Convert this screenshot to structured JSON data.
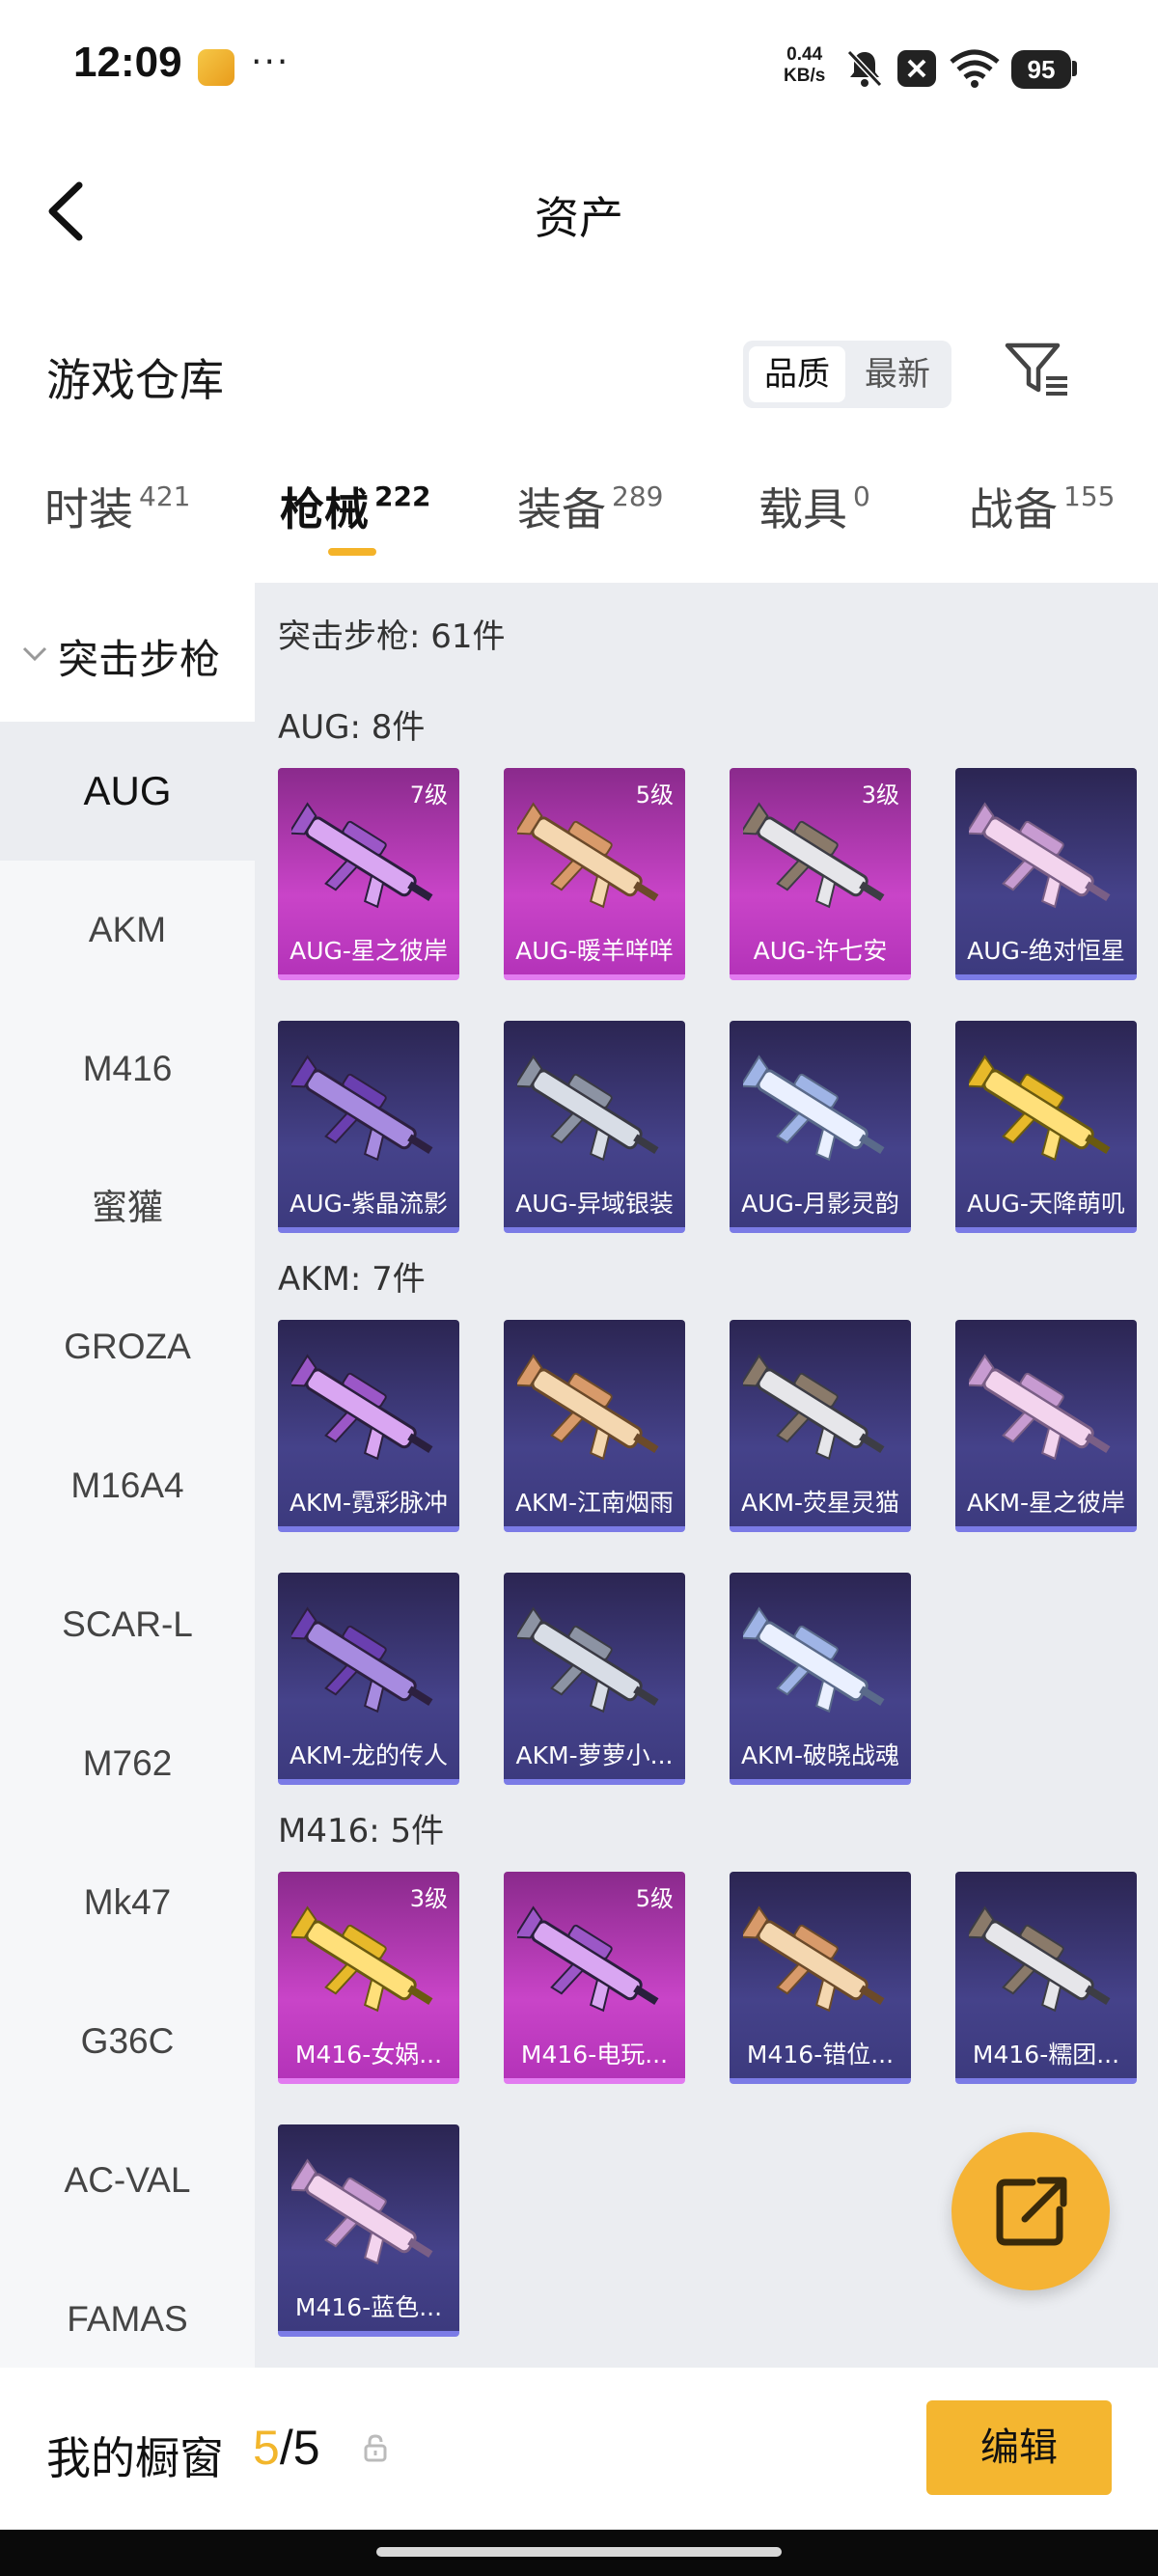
{
  "status_bar": {
    "time": "12:09",
    "dots": "···",
    "net_speed_value": "0.44",
    "net_speed_unit": "KB/s",
    "battery": "95"
  },
  "nav": {
    "title": "资产"
  },
  "warehouse": {
    "title": "游戏仓库",
    "sort_options": [
      "品质",
      "最新"
    ],
    "sort_selected": "品质"
  },
  "tabs": [
    {
      "label": "时装",
      "count": "421"
    },
    {
      "label": "枪械",
      "count": "222",
      "active": true
    },
    {
      "label": "装备",
      "count": "289"
    },
    {
      "label": "载具",
      "count": "0"
    },
    {
      "label": "战备",
      "count": "155"
    }
  ],
  "sidebar": {
    "category": "突击步枪",
    "items": [
      "AUG",
      "AKM",
      "M416",
      "蜜獾",
      "GROZA",
      "M16A4",
      "SCAR-L",
      "M762",
      "Mk47",
      "G36C",
      "AC-VAL",
      "FAMAS"
    ],
    "selected": "AUG"
  },
  "content": {
    "category_heading": "突击步枪: 61件",
    "groups": [
      {
        "heading": "AUG: 8件",
        "items": [
          {
            "name": "AUG-星之彼岸",
            "level": "7级",
            "rarity": "purple"
          },
          {
            "name": "AUG-暖羊咩咩",
            "level": "5级",
            "rarity": "purple"
          },
          {
            "name": "AUG-许七安",
            "level": "3级",
            "rarity": "purple"
          },
          {
            "name": "AUG-绝对恒星",
            "level": "",
            "rarity": "blue"
          },
          {
            "name": "AUG-紫晶流影",
            "level": "",
            "rarity": "blue"
          },
          {
            "name": "AUG-异域银装",
            "level": "",
            "rarity": "blue"
          },
          {
            "name": "AUG-月影灵韵",
            "level": "",
            "rarity": "blue"
          },
          {
            "name": "AUG-天降萌叽",
            "level": "",
            "rarity": "blue"
          }
        ]
      },
      {
        "heading": "AKM: 7件",
        "items": [
          {
            "name": "AKM-霓彩脉冲",
            "level": "",
            "rarity": "blue"
          },
          {
            "name": "AKM-江南烟雨",
            "level": "",
            "rarity": "blue"
          },
          {
            "name": "AKM-荧星灵猫",
            "level": "",
            "rarity": "blue"
          },
          {
            "name": "AKM-星之彼岸",
            "level": "",
            "rarity": "blue"
          },
          {
            "name": "AKM-龙的传人",
            "level": "",
            "rarity": "blue"
          },
          {
            "name": "AKM-萝萝小...",
            "level": "",
            "rarity": "blue"
          },
          {
            "name": "AKM-破晓战魂",
            "level": "",
            "rarity": "blue"
          }
        ]
      },
      {
        "heading": "M416: 5件",
        "items": [
          {
            "name": "M416-女娲...",
            "level": "3级",
            "rarity": "purple"
          },
          {
            "name": "M416-电玩...",
            "level": "5级",
            "rarity": "purple"
          },
          {
            "name": "M416-错位...",
            "level": "",
            "rarity": "blue"
          },
          {
            "name": "M416-糯团...",
            "level": "",
            "rarity": "blue"
          },
          {
            "name": "M416-蓝色...",
            "level": "",
            "rarity": "blue"
          }
        ]
      }
    ]
  },
  "showcase": {
    "label": "我的橱窗",
    "used": "5",
    "total": "/5",
    "edit_label": "编辑"
  },
  "colors": {
    "accent": "#f4b630",
    "epic_card": "#c944c8",
    "rare_card": "#45428a"
  },
  "icons": [
    "back-arrow-icon",
    "filter-icon",
    "chevron-down-icon",
    "lock-icon",
    "share-external-icon",
    "wifi-icon",
    "mute-bell-icon"
  ]
}
